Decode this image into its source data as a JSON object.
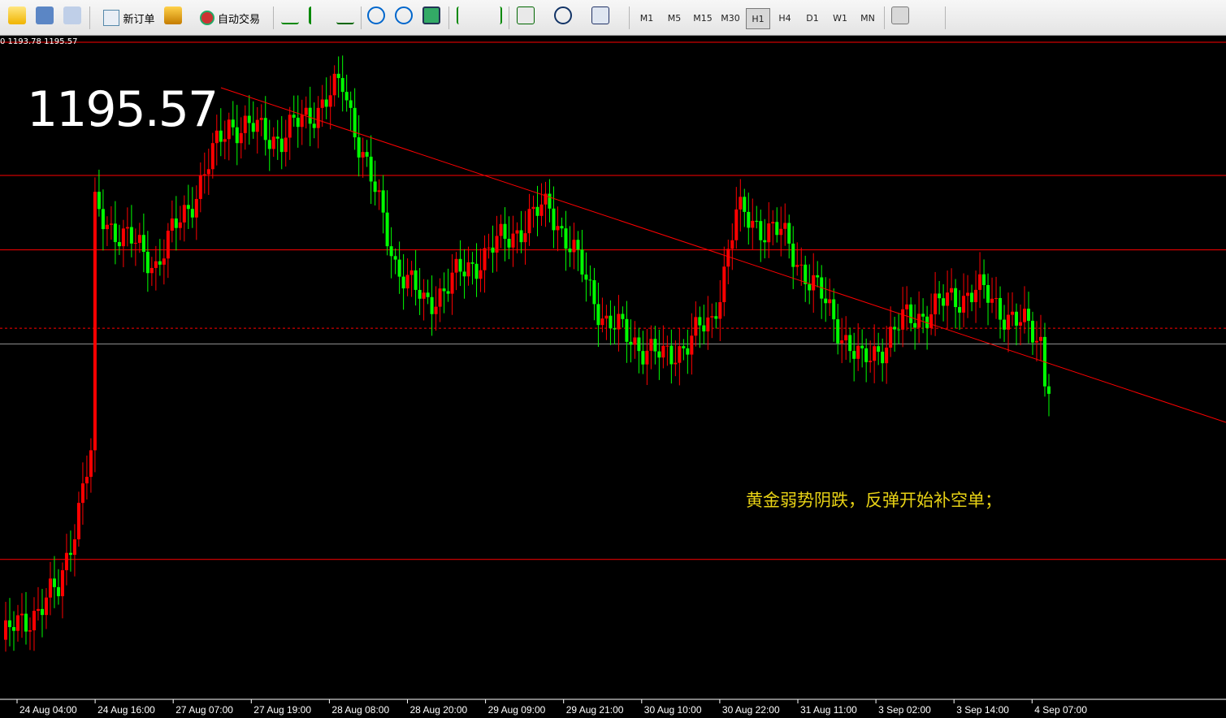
{
  "toolbar": {
    "new_order_label": "新订单",
    "auto_trading_label": "自动交易",
    "timeframes": [
      "M1",
      "M5",
      "M15",
      "M30",
      "H1",
      "H4",
      "D1",
      "W1",
      "MN"
    ],
    "active_timeframe": "H1"
  },
  "chart_info": "0 1193.78 1195.57",
  "big_price": "1195.57",
  "annotation": "黄金弱势阴跌，反弹开始补空单；",
  "colors": {
    "bull": "#ff0000",
    "bear": "#00ff00",
    "line": "#ff0000",
    "background": "#000000",
    "grid_text": "#ffffff"
  },
  "chart_data": {
    "type": "candlestick",
    "x_labels": [
      "24 Aug 04:00",
      "24 Aug 16:00",
      "27 Aug 07:00",
      "27 Aug 19:00",
      "28 Aug 08:00",
      "28 Aug 20:00",
      "29 Aug 09:00",
      "29 Aug 21:00",
      "30 Aug 10:00",
      "30 Aug 22:00",
      "31 Aug 11:00",
      "3 Sep 02:00",
      "3 Sep 14:00",
      "4 Sep 07:00"
    ],
    "ylim": [
      1183.3,
      1216.8
    ],
    "horizontal_levels": [
      1216.8,
      1210.0,
      1206.2,
      1202.2,
      1201.4,
      1190.4
    ],
    "trendline": [
      [
        1209.8,
        1209.8
      ],
      [
        1213.5,
        1200.9
      ]
    ],
    "current_price": 1195.57
  }
}
